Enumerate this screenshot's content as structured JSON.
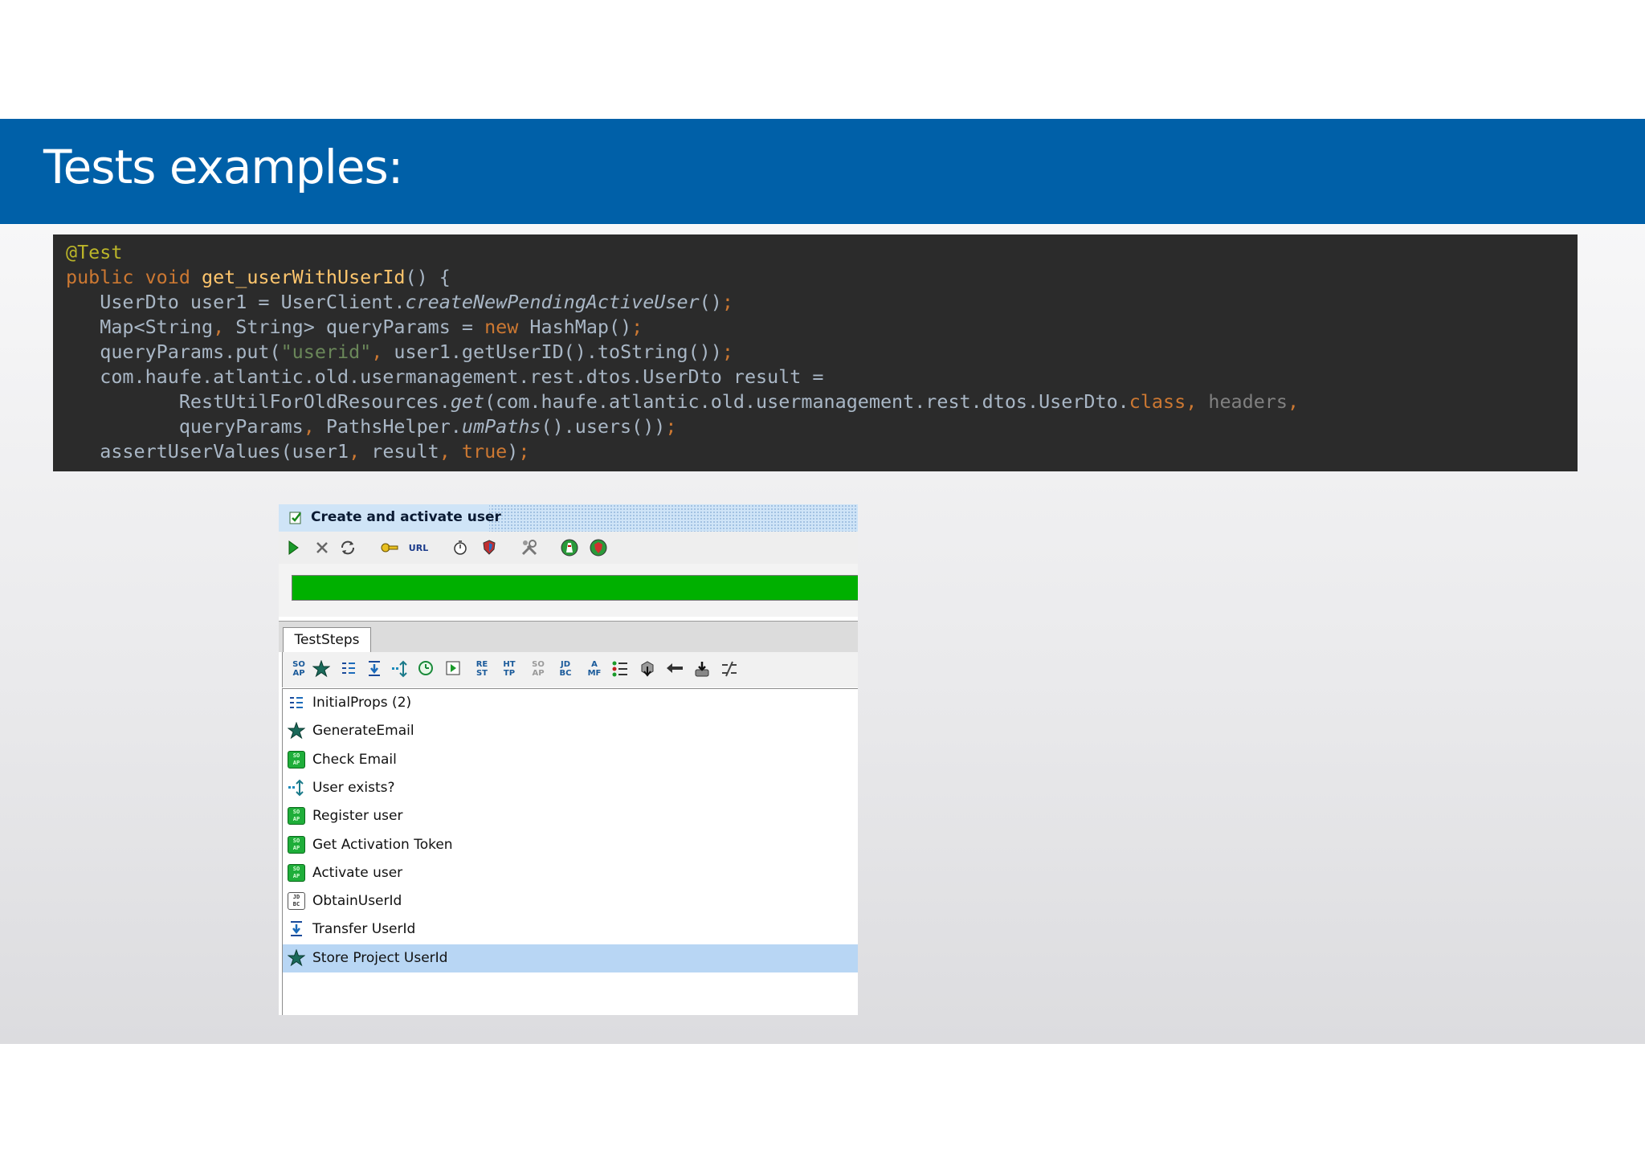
{
  "slide": {
    "title": "Tests examples:"
  },
  "code": {
    "lines": [
      [
        {
          "t": "@Test",
          "c": "ann"
        }
      ],
      [
        {
          "t": "public void ",
          "c": "kw"
        },
        {
          "t": "get_userWithUserId",
          "c": "fn"
        },
        {
          "t": "() {",
          "c": ""
        }
      ],
      [
        {
          "t": "   UserDto user1 = UserClient.",
          "c": ""
        },
        {
          "t": "createNewPendingActiveUser",
          "c": "it"
        },
        {
          "t": "()",
          "c": ""
        },
        {
          "t": ";",
          "c": "kw"
        }
      ],
      [
        {
          "t": "   Map<String",
          "c": ""
        },
        {
          "t": ", ",
          "c": "kw"
        },
        {
          "t": "String> queryParams = ",
          "c": ""
        },
        {
          "t": "new ",
          "c": "kw"
        },
        {
          "t": "HashMap()",
          "c": ""
        },
        {
          "t": ";",
          "c": "kw"
        }
      ],
      [
        {
          "t": "   queryParams.put(",
          "c": ""
        },
        {
          "t": "\"userid\"",
          "c": "str"
        },
        {
          "t": ", ",
          "c": "kw"
        },
        {
          "t": "user1.getUserID().toString())",
          "c": ""
        },
        {
          "t": ";",
          "c": "kw"
        }
      ],
      [
        {
          "t": "   com.haufe.atlantic.old.usermanagement.rest.dtos.UserDto result =",
          "c": ""
        }
      ],
      [
        {
          "t": "          RestUtilForOldResources.",
          "c": ""
        },
        {
          "t": "get",
          "c": "it"
        },
        {
          "t": "(com.haufe.atlantic.old.usermanagement.rest.dtos.UserDto.",
          "c": ""
        },
        {
          "t": "class",
          "c": "kw"
        },
        {
          "t": ", ",
          "c": "kw"
        },
        {
          "t": "headers",
          "c": "dim"
        },
        {
          "t": ",",
          "c": "kw"
        }
      ],
      [
        {
          "t": "          queryParams",
          "c": ""
        },
        {
          "t": ", ",
          "c": "kw"
        },
        {
          "t": "PathsHelper.",
          "c": ""
        },
        {
          "t": "umPaths",
          "c": "it"
        },
        {
          "t": "().users())",
          "c": ""
        },
        {
          "t": ";",
          "c": "kw"
        }
      ],
      [
        {
          "t": "   assertUserValues(user1",
          "c": ""
        },
        {
          "t": ", ",
          "c": "kw"
        },
        {
          "t": "result",
          "c": ""
        },
        {
          "t": ", ",
          "c": "kw"
        },
        {
          "t": "true",
          "c": "kw"
        },
        {
          "t": ")",
          "c": ""
        },
        {
          "t": ";",
          "c": "kw"
        }
      ]
    ]
  },
  "soapui": {
    "window_title": "Create and activate user",
    "progress_fraction": 1.0,
    "tab_label": "TestSteps",
    "url_label": "URL",
    "toolbar2_labels": [
      "SO AP",
      "RE ST",
      "HT TP",
      "SO AP",
      "JD BC",
      "A MF"
    ],
    "steps": [
      {
        "label": "InitialProps (2)",
        "icon": "properties-icon",
        "selected": false
      },
      {
        "label": "GenerateEmail",
        "icon": "groovy-star-icon",
        "selected": false
      },
      {
        "label": "Check Email",
        "icon": "soap-request-icon",
        "selected": false
      },
      {
        "label": "User exists?",
        "icon": "conditional-goto-icon",
        "selected": false
      },
      {
        "label": "Register user",
        "icon": "soap-request-icon",
        "selected": false
      },
      {
        "label": "Get Activation Token",
        "icon": "soap-request-icon",
        "selected": false
      },
      {
        "label": "Activate user",
        "icon": "soap-request-icon",
        "selected": false
      },
      {
        "label": "ObtainUserId",
        "icon": "jdbc-request-icon",
        "selected": false
      },
      {
        "label": "Transfer UserId",
        "icon": "property-transfer-icon",
        "selected": false
      },
      {
        "label": "Store Project UserId",
        "icon": "groovy-star-icon",
        "selected": true
      }
    ]
  },
  "colors": {
    "title_bar": "#0060a8",
    "code_bg": "#2b2b2b",
    "progress": "#00b000",
    "selection": "#b8d6f4"
  }
}
